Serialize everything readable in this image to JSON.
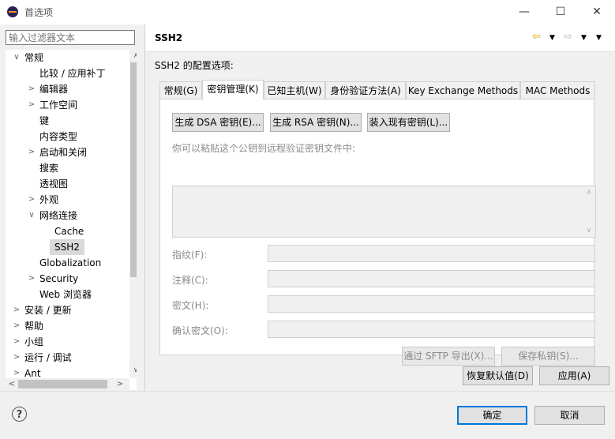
{
  "window": {
    "title": "首选项",
    "minimize": "—",
    "maximize": "☐",
    "close": "✕"
  },
  "filter": {
    "placeholder": "输入过滤器文本"
  },
  "tree": {
    "items": [
      {
        "label": "常规",
        "indent": 0,
        "arrow": "∨"
      },
      {
        "label": "比较 / 应用补丁",
        "indent": 1,
        "arrow": ""
      },
      {
        "label": "编辑器",
        "indent": 1,
        "arrow": ">"
      },
      {
        "label": "工作空间",
        "indent": 1,
        "arrow": ">"
      },
      {
        "label": "键",
        "indent": 1,
        "arrow": ""
      },
      {
        "label": "内容类型",
        "indent": 1,
        "arrow": ""
      },
      {
        "label": "启动和关闭",
        "indent": 1,
        "arrow": ">"
      },
      {
        "label": "搜索",
        "indent": 1,
        "arrow": ""
      },
      {
        "label": "透视图",
        "indent": 1,
        "arrow": ""
      },
      {
        "label": "外观",
        "indent": 1,
        "arrow": ">"
      },
      {
        "label": "网络连接",
        "indent": 1,
        "arrow": "∨"
      },
      {
        "label": "Cache",
        "indent": 2,
        "arrow": ""
      },
      {
        "label": "SSH2",
        "indent": 2,
        "arrow": "",
        "selected": true
      },
      {
        "label": "Globalization",
        "indent": 1,
        "arrow": ""
      },
      {
        "label": "Security",
        "indent": 1,
        "arrow": ">"
      },
      {
        "label": "Web 浏览器",
        "indent": 1,
        "arrow": ""
      },
      {
        "label": "安装 / 更新",
        "indent": 0,
        "arrow": ">"
      },
      {
        "label": "帮助",
        "indent": 0,
        "arrow": ">"
      },
      {
        "label": "小组",
        "indent": 0,
        "arrow": ">"
      },
      {
        "label": "运行 / 调试",
        "indent": 0,
        "arrow": ">"
      },
      {
        "label": "Ant",
        "indent": 0,
        "arrow": ">"
      }
    ]
  },
  "page": {
    "title": "SSH2",
    "description": "SSH2 的配置选项:",
    "tabs": [
      {
        "label": "常规(G)",
        "active": false
      },
      {
        "label": "密钥管理(K)",
        "active": true
      },
      {
        "label": "已知主机(W)",
        "active": false
      },
      {
        "label": "身份验证方法(A)",
        "active": false
      },
      {
        "label": "Key Exchange Methods",
        "active": false
      },
      {
        "label": "MAC Methods",
        "active": false
      }
    ],
    "buttons": {
      "gen_dsa": "生成 DSA 密钥(E)...",
      "gen_rsa": "生成 RSA 密钥(N)...",
      "load_key": "装入现有密钥(L)..."
    },
    "paste_label": "你可以粘贴这个公钥到远程验证密钥文件中:",
    "fields": {
      "fingerprint": "指纹(F):",
      "comment": "注释(C):",
      "passphrase": "密文(H):",
      "confirm": "确认密文(O):"
    },
    "export_sftp": "通过 SFTP 导出(X)...",
    "save_private": "保存私钥(S)...",
    "restore_defaults": "恢复默认值(D)",
    "apply": "应用(A)"
  },
  "footer": {
    "ok": "确定",
    "cancel": "取消",
    "help": "?"
  },
  "colors": {
    "accent": "#0078d7",
    "nav_back": "#e8a100",
    "selected_bg": "#d9d9d9"
  }
}
